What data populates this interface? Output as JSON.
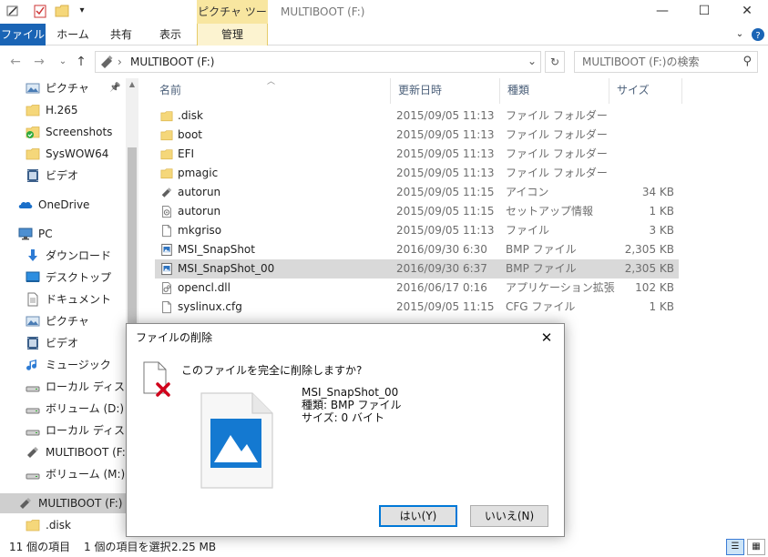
{
  "window": {
    "title": "MULTIBOOT (F:)",
    "contextual_tab": "ピクチャ ツール",
    "minimize_glyph": "—",
    "maximize_glyph": "☐",
    "close_glyph": "✕"
  },
  "ribbon": {
    "tabs": [
      {
        "label": "ファイル"
      },
      {
        "label": "ホーム"
      },
      {
        "label": "共有"
      },
      {
        "label": "表示"
      },
      {
        "label": "管理"
      }
    ]
  },
  "address": {
    "back_glyph": "←",
    "forward_glyph": "→",
    "up_glyph": "↑",
    "separator": "›",
    "path": "MULTIBOOT (F:)",
    "dropdown_glyph": "⌄",
    "refresh_glyph": "↻",
    "search_placeholder": "MULTIBOOT (F:)の検索",
    "search_glyph": "⚲"
  },
  "sidebar": {
    "items": [
      {
        "label": "ピクチャ",
        "icon": "pictures-icon",
        "pinned": true
      },
      {
        "label": "H.265",
        "icon": "folder-icon"
      },
      {
        "label": "Screenshots",
        "icon": "folder-synced-icon"
      },
      {
        "label": "SysWOW64",
        "icon": "folder-icon"
      },
      {
        "label": "ビデオ",
        "icon": "video-icon"
      },
      {
        "label": "OneDrive",
        "icon": "onedrive-icon"
      },
      {
        "label": "PC",
        "icon": "pc-icon"
      },
      {
        "label": "ダウンロード",
        "icon": "download-icon"
      },
      {
        "label": "デスクトップ",
        "icon": "desktop-icon"
      },
      {
        "label": "ドキュメント",
        "icon": "documents-icon"
      },
      {
        "label": "ピクチャ",
        "icon": "pictures-icon"
      },
      {
        "label": "ビデオ",
        "icon": "video-icon"
      },
      {
        "label": "ミュージック",
        "icon": "music-icon"
      },
      {
        "label": "ローカル ディスク (C",
        "icon": "drive-icon"
      },
      {
        "label": "ボリューム (D:)",
        "icon": "drive-icon"
      },
      {
        "label": "ローカル ディスク (E",
        "icon": "drive-icon"
      },
      {
        "label": "MULTIBOOT (F:)",
        "icon": "usb-drive-icon"
      },
      {
        "label": "ボリューム (M:)",
        "icon": "drive-icon"
      },
      {
        "label": "MULTIBOOT (F:)",
        "icon": "usb-drive-icon",
        "selected": true
      },
      {
        "label": ".disk",
        "icon": "folder-icon"
      }
    ],
    "pin_glyph": "📌"
  },
  "columns": {
    "name": "名前",
    "date": "更新日時",
    "type": "種類",
    "size": "サイズ"
  },
  "files": [
    {
      "name": ".disk",
      "date": "2015/09/05 11:13",
      "type": "ファイル フォルダー",
      "size": "",
      "icon": "folder-icon"
    },
    {
      "name": "boot",
      "date": "2015/09/05 11:13",
      "type": "ファイル フォルダー",
      "size": "",
      "icon": "folder-icon"
    },
    {
      "name": "EFI",
      "date": "2015/09/05 11:13",
      "type": "ファイル フォルダー",
      "size": "",
      "icon": "folder-icon"
    },
    {
      "name": "pmagic",
      "date": "2015/09/05 11:13",
      "type": "ファイル フォルダー",
      "size": "",
      "icon": "folder-icon"
    },
    {
      "name": "autorun",
      "date": "2015/09/05 11:15",
      "type": "アイコン",
      "size": "34 KB",
      "icon": "usb-drive-icon"
    },
    {
      "name": "autorun",
      "date": "2015/09/05 11:15",
      "type": "セットアップ情報",
      "size": "1 KB",
      "icon": "settings-file-icon"
    },
    {
      "name": "mkgriso",
      "date": "2015/09/05 11:13",
      "type": "ファイル",
      "size": "3 KB",
      "icon": "file-icon"
    },
    {
      "name": "MSI_SnapShot",
      "date": "2016/09/30 6:30",
      "type": "BMP ファイル",
      "size": "2,305 KB",
      "icon": "image-file-icon"
    },
    {
      "name": "MSI_SnapShot_00",
      "date": "2016/09/30 6:37",
      "type": "BMP ファイル",
      "size": "2,305 KB",
      "icon": "image-file-icon",
      "selected": true
    },
    {
      "name": "opencl.dll",
      "date": "2016/06/17 0:16",
      "type": "アプリケーション拡張",
      "size": "102 KB",
      "icon": "dll-file-icon"
    },
    {
      "name": "syslinux.cfg",
      "date": "2015/09/05 11:15",
      "type": "CFG ファイル",
      "size": "1 KB",
      "icon": "file-icon"
    }
  ],
  "status": {
    "count": "11 個の項目",
    "selected": "1 個の項目を選択",
    "size": "2.25 MB"
  },
  "dialog": {
    "title": "ファイルの削除",
    "close_glyph": "✕",
    "question": "このファイルを完全に削除しますか?",
    "file_name": "MSI_SnapShot_00",
    "file_type": "種類: BMP ファイル",
    "file_size": "サイズ: 0 バイト",
    "yes_label": "はい(Y)",
    "no_label": "いいえ(N)"
  },
  "colors": {
    "accent": "#1a64b5",
    "contextual": "#f8e6a0",
    "folder": "#f5d77a",
    "selection": "#d9d9d9",
    "danger": "#d0021b",
    "image_blue": "#1479d1"
  }
}
